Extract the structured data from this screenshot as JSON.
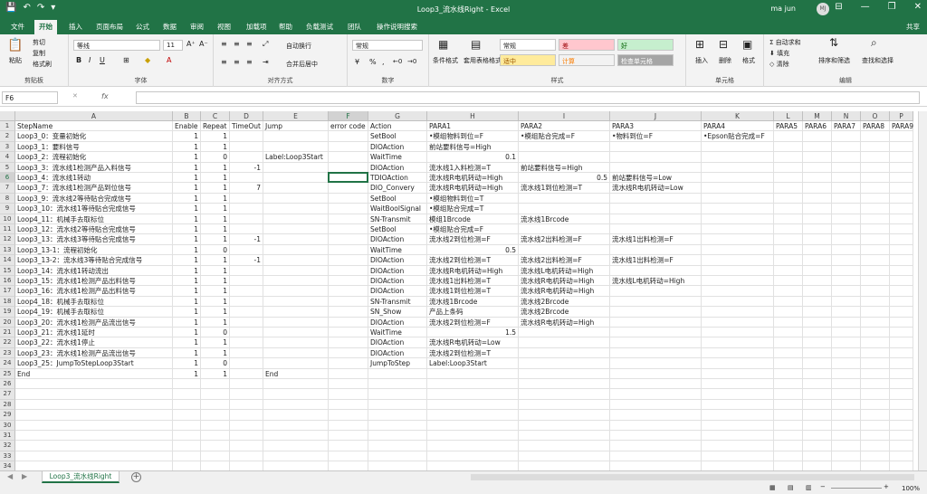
{
  "window": {
    "title": "Loop3_流水线Right - Excel",
    "user": "ma jun",
    "avatar": "MJ"
  },
  "tabs": [
    "文件",
    "开始",
    "插入",
    "页面布局",
    "公式",
    "数据",
    "审阅",
    "视图",
    "加载项",
    "帮助",
    "负载测试",
    "团队",
    "操作说明搜索"
  ],
  "active_tab": "开始",
  "share_label": "共享",
  "ribbon": {
    "clipboard": {
      "paste": "粘贴",
      "cut": "剪切",
      "copy": "复制",
      "format_painter": "格式刷",
      "label": "剪贴板"
    },
    "font": {
      "name": "等线",
      "size": "11",
      "label": "字体"
    },
    "alignment": {
      "wrap": "自动换行",
      "merge": "合并后居中",
      "label": "对齐方式"
    },
    "number": {
      "format": "常规",
      "label": "数字"
    },
    "styles": {
      "conditional": "条件格式",
      "table": "套用表格格式",
      "normal": "常规",
      "bad": "差",
      "good": "好",
      "neutral": "适中",
      "calc": "计算",
      "check": "检查单元格",
      "label": "样式"
    },
    "cells": {
      "insert": "插入",
      "delete": "删除",
      "format": "格式",
      "label": "单元格"
    },
    "editing": {
      "autosum": "自动求和",
      "fill": "填充",
      "clear": "清除",
      "sort": "排序和筛选",
      "find": "查找和选择",
      "label": "编辑"
    }
  },
  "formula_bar": {
    "name_box": "F6",
    "fx": "fx",
    "value": ""
  },
  "columns": [
    {
      "id": "A",
      "w": 174
    },
    {
      "id": "B",
      "w": 31
    },
    {
      "id": "C",
      "w": 32
    },
    {
      "id": "D",
      "w": 37
    },
    {
      "id": "E",
      "w": 72
    },
    {
      "id": "F",
      "w": 44
    },
    {
      "id": "G",
      "w": 65
    },
    {
      "id": "H",
      "w": 101
    },
    {
      "id": "I",
      "w": 101
    },
    {
      "id": "J",
      "w": 101
    },
    {
      "id": "K",
      "w": 80
    },
    {
      "id": "L",
      "w": 32
    },
    {
      "id": "M",
      "w": 32
    },
    {
      "id": "N",
      "w": 32
    },
    {
      "id": "O",
      "w": 32
    },
    {
      "id": "P",
      "w": 26
    }
  ],
  "selected": {
    "col": "F",
    "row": 6
  },
  "rows": [
    [
      "StepName",
      "Enable",
      "Repeat",
      "TimeOut",
      "Jump",
      "error code",
      "Action",
      "PARA1",
      "PARA2",
      "PARA3",
      "PARA4",
      "PARA5",
      "PARA6",
      "PARA7",
      "PARA8",
      "PARA9"
    ],
    [
      "Loop3_0：变量初始化",
      "1",
      "1",
      "",
      "",
      "",
      "SetBool",
      "•模组物料到位=F",
      "•模组贴合完成=F",
      "•物料到位=F",
      "•Epson贴合完成=F",
      "",
      "",
      "",
      "",
      ""
    ],
    [
      "Loop3_1：要料信号",
      "1",
      "1",
      "",
      "",
      "",
      "DIOAction",
      "前站要料信号=High",
      "",
      "",
      "",
      "",
      "",
      "",
      "",
      ""
    ],
    [
      "Loop3_2：流程初始化",
      "1",
      "0",
      "",
      "Label:Loop3Start",
      "",
      "WaitTime",
      "0.1",
      "",
      "",
      "",
      "",
      "",
      "",
      "",
      ""
    ],
    [
      "Loop3_3：流水线1检测产品入料信号",
      "1",
      "1",
      "-1",
      "",
      "",
      "DIOAction",
      "流水线1入料检测=T",
      "前站要料信号=High",
      "",
      "",
      "",
      "",
      "",
      "",
      ""
    ],
    [
      "Loop3_4：流水线1转动",
      "1",
      "1",
      "",
      "",
      "",
      "TDIOAction",
      "流水线R电机转动=High",
      "0.5",
      "前站要料信号=Low",
      "",
      "",
      "",
      "",
      "",
      ""
    ],
    [
      "Loop3_7：流水线1检测产品到位信号",
      "1",
      "1",
      "7",
      "",
      "",
      "DIO_Convery",
      "流水线R电机转动=High",
      "流水线1到位检测=T",
      "流水线R电机转动=Low",
      "",
      "",
      "",
      "",
      "",
      ""
    ],
    [
      "Loop3_9：流水线2等待贴合完成信号",
      "1",
      "1",
      "",
      "",
      "",
      "SetBool",
      "•模组物料到位=T",
      "",
      "",
      "",
      "",
      "",
      "",
      "",
      ""
    ],
    [
      "Loop3_10：流水线1等待贴合完成信号",
      "1",
      "1",
      "",
      "",
      "",
      "WaitBoolSignal",
      "•模组贴合完成=T",
      "",
      "",
      "",
      "",
      "",
      "",
      "",
      ""
    ],
    [
      "Loop4_11：机械手去取标位",
      "1",
      "1",
      "",
      "",
      "",
      "SN-Transmit",
      "模组1Brcode",
      "流水线1Brcode",
      "",
      "",
      "",
      "",
      "",
      "",
      ""
    ],
    [
      "Loop3_12：流水线2等待贴合完成信号",
      "1",
      "1",
      "",
      "",
      "",
      "SetBool",
      "•模组贴合完成=F",
      "",
      "",
      "",
      "",
      "",
      "",
      "",
      ""
    ],
    [
      "Loop3_13：流水线3等待贴合完成信号",
      "1",
      "1",
      "-1",
      "",
      "",
      "DIOAction",
      "流水线2到位检测=F",
      "流水线2出料检测=F",
      "流水线1出料检测=F",
      "",
      "",
      "",
      "",
      "",
      ""
    ],
    [
      "Loop3_13-1：流程初始化",
      "1",
      "0",
      "",
      "",
      "",
      "WaitTime",
      "0.5",
      "",
      "",
      "",
      "",
      "",
      "",
      "",
      ""
    ],
    [
      "Loop3_13-2：流水线3等待贴合完成信号",
      "1",
      "1",
      "-1",
      "",
      "",
      "DIOAction",
      "流水线2到位检测=T",
      "流水线2出料检测=F",
      "流水线1出料检测=F",
      "",
      "",
      "",
      "",
      "",
      ""
    ],
    [
      "Loop3_14：流水线1转动流出",
      "1",
      "1",
      "",
      "",
      "",
      "DIOAction",
      "流水线R电机转动=High",
      "流水线L电机转动=High",
      "",
      "",
      "",
      "",
      "",
      "",
      ""
    ],
    [
      "Loop3_15：流水线1检测产品出料信号",
      "1",
      "1",
      "",
      "",
      "",
      "DIOAction",
      "流水线1出料检测=T",
      "流水线R电机转动=High",
      "流水线L电机转动=High",
      "",
      "",
      "",
      "",
      "",
      ""
    ],
    [
      "Loop3_16：流水线1检测产品出料信号",
      "1",
      "1",
      "",
      "",
      "",
      "DIOAction",
      "流水线1到位检测=T",
      "流水线R电机转动=High",
      "",
      "",
      "",
      "",
      "",
      "",
      ""
    ],
    [
      "Loop4_18：机械手去取标位",
      "1",
      "1",
      "",
      "",
      "",
      "SN-Transmit",
      "流水线1Brcode",
      "流水线2Brcode",
      "",
      "",
      "",
      "",
      "",
      "",
      ""
    ],
    [
      "Loop4_19：机械手去取标位",
      "1",
      "1",
      "",
      "",
      "",
      "SN_Show",
      "产品上条码",
      "流水线2Brcode",
      "",
      "",
      "",
      "",
      "",
      "",
      ""
    ],
    [
      "Loop3_20：流水线1检测产品流出信号",
      "1",
      "1",
      "",
      "",
      "",
      "DIOAction",
      "流水线2到位检测=F",
      "流水线R电机转动=High",
      "",
      "",
      "",
      "",
      "",
      "",
      ""
    ],
    [
      "Loop3_21：流水线1延时",
      "1",
      "0",
      "",
      "",
      "",
      "WaitTime",
      "1.5",
      "",
      "",
      "",
      "",
      "",
      "",
      "",
      ""
    ],
    [
      "Loop3_22：流水线1停止",
      "1",
      "1",
      "",
      "",
      "",
      "DIOAction",
      "流水线R电机转动=Low",
      "",
      "",
      "",
      "",
      "",
      "",
      "",
      ""
    ],
    [
      "Loop3_23：流水线1检测产品流出信号",
      "1",
      "1",
      "",
      "",
      "",
      "DIOAction",
      "流水线2到位检测=T",
      "",
      "",
      "",
      "",
      "",
      "",
      "",
      ""
    ],
    [
      "Loop3_25：JumpToStepLoop3Start",
      "1",
      "0",
      "",
      "",
      "",
      "JumpToStep",
      "Label:Loop3Start",
      "",
      "",
      "",
      "",
      "",
      "",
      "",
      ""
    ],
    [
      "End",
      "1",
      "1",
      "",
      "End",
      "",
      "",
      "",
      "",
      "",
      "",
      "",
      "",
      "",
      "",
      ""
    ]
  ],
  "row_count": 34,
  "sheet_tab": "Loop3_流水线Right",
  "status": {
    "zoom": "100%"
  }
}
